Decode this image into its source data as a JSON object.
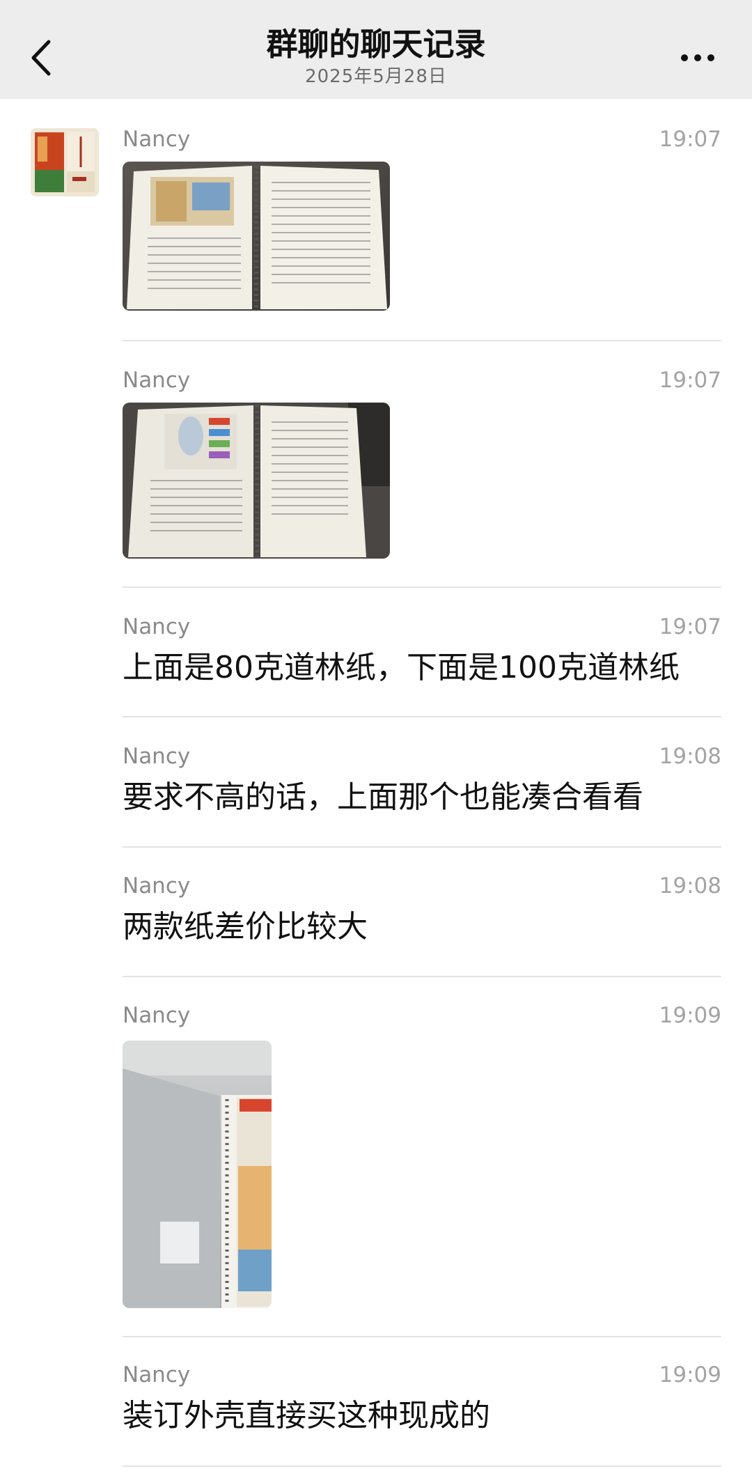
{
  "header": {
    "title": "群聊的聊天记录",
    "date": "2025年5月28日"
  },
  "messages": [
    {
      "sender": "Nancy",
      "time": "19:07",
      "type": "image",
      "image": "open spiral book with Africa map photo"
    },
    {
      "sender": "Nancy",
      "time": "19:07",
      "type": "image",
      "image": "open spiral book with body diagram photo"
    },
    {
      "sender": "Nancy",
      "time": "19:07",
      "type": "text",
      "text": "上面是80克道林纸，下面是100克道林纸"
    },
    {
      "sender": "Nancy",
      "time": "19:08",
      "type": "text",
      "text": "要求不高的话，上面那个也能凑合看看"
    },
    {
      "sender": "Nancy",
      "time": "19:08",
      "type": "text",
      "text": "两款纸差价比较大"
    },
    {
      "sender": "Nancy",
      "time": "19:09",
      "type": "image",
      "image": "frosted binder cover photo"
    },
    {
      "sender": "Nancy",
      "time": "19:09",
      "type": "text",
      "text": "装订外壳直接买这种现成的"
    }
  ],
  "colors": {
    "header_bg": "#ededed",
    "sender": "#8a8a8a",
    "time": "#a3a3a3",
    "divider": "#e3e3e3"
  },
  "icons": {
    "back": "chevron-left-icon",
    "more": "more-dots-icon"
  }
}
